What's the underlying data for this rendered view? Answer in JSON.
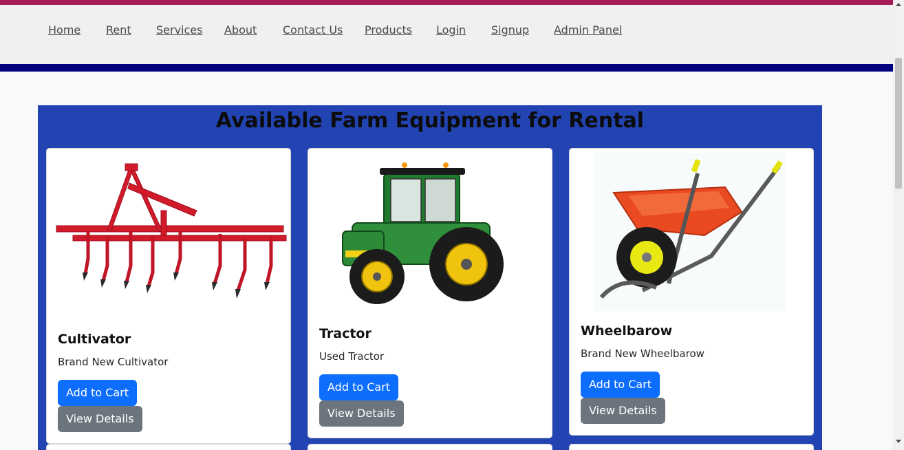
{
  "nav": {
    "links": [
      "Home",
      "Rent",
      "Services",
      "About",
      "Contact Us",
      "Products",
      "Login",
      "Signup",
      "Admin Panel"
    ]
  },
  "main": {
    "title": "Available Farm Equipment for Rental",
    "cards": [
      {
        "title": "Cultivator",
        "description": "Brand New Cultivator",
        "add_label": "Add to Cart",
        "details_label": "View Details",
        "image": "cultivator-image"
      },
      {
        "title": "Tractor",
        "description": "Used Tractor",
        "add_label": "Add to Cart",
        "details_label": "View Details",
        "image": "tractor-image"
      },
      {
        "title": "Wheelbarow",
        "description": "Brand New Wheelbarow",
        "add_label": "Add to Cart",
        "details_label": "View Details",
        "image": "wheelbarrow-image"
      }
    ]
  },
  "colors": {
    "top_accent": "#a61b55",
    "nav_background": "#eef0f2",
    "nav_underline": "#00007e",
    "section_background": "#2243b2",
    "primary_button": "#0d6efd",
    "secondary_button": "#6c757d"
  }
}
